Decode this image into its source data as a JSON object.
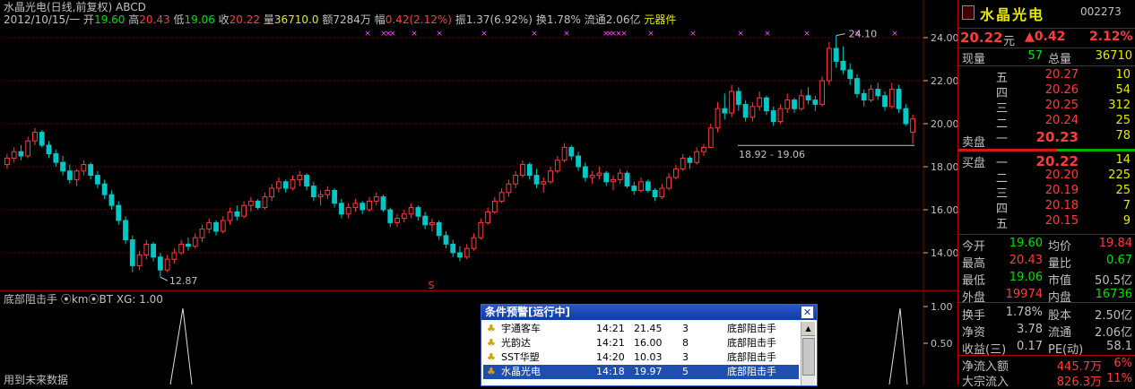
{
  "chart": {
    "title": "水晶光电(日线,前复权) ABCD",
    "info": {
      "date": "2012/10/15/一",
      "open_label": "开",
      "open": "19.60",
      "high_label": "高",
      "high": "20.43",
      "low_label": "低",
      "low": "19.06",
      "close_label": "收",
      "close": "20.22",
      "vol_label": "量",
      "vol": "36710.0",
      "amt_label": "额",
      "amt": "7284万",
      "chg_label": "幅",
      "chg": "0.42(2.12%)",
      "amp_label": "振",
      "amp": "1.37(6.92%)",
      "turn_label": "换",
      "turn": "1.78%",
      "float_label": "流通",
      "float": "2.06亿",
      "sector": "元器件"
    },
    "y_ticks": [
      "24.00",
      "22.00",
      "20.00",
      "18.00",
      "16.00",
      "14.00"
    ],
    "annotations": {
      "high_mark": "24.10",
      "low_mark": "12.87",
      "range": "18.92 - 19.06",
      "signal": "S"
    },
    "indicator": {
      "title": "底部阻击手 ⦿km⦿BT XG: 1.00",
      "ticks": [
        "1.00",
        "0.50"
      ]
    },
    "sub_text": "用到未来数据",
    "colors": {
      "up": "#ff3b3b",
      "down": "#00c8c8",
      "grid": "#800000",
      "marker": "#ff40ff"
    }
  },
  "chart_data": {
    "type": "candlestick",
    "y_range": [
      12.5,
      24.5
    ],
    "candles": [
      [
        18.1,
        18.6,
        17.9,
        18.4
      ],
      [
        18.4,
        18.9,
        18.2,
        18.7
      ],
      [
        18.7,
        19.0,
        18.3,
        18.5
      ],
      [
        18.5,
        19.4,
        18.4,
        19.2
      ],
      [
        19.2,
        19.8,
        19.0,
        19.6
      ],
      [
        19.6,
        19.7,
        18.9,
        19.0
      ],
      [
        19.0,
        19.2,
        18.4,
        18.6
      ],
      [
        18.6,
        18.8,
        18.0,
        18.2
      ],
      [
        18.2,
        18.5,
        17.6,
        17.8
      ],
      [
        17.8,
        18.1,
        17.2,
        17.4
      ],
      [
        17.4,
        17.9,
        17.1,
        17.8
      ],
      [
        17.8,
        18.3,
        17.6,
        18.1
      ],
      [
        18.1,
        18.2,
        17.4,
        17.6
      ],
      [
        17.6,
        17.8,
        17.0,
        17.2
      ],
      [
        17.2,
        17.4,
        16.5,
        16.7
      ],
      [
        16.7,
        16.9,
        16.0,
        16.2
      ],
      [
        16.2,
        16.4,
        15.3,
        15.5
      ],
      [
        15.5,
        15.7,
        14.4,
        14.6
      ],
      [
        14.6,
        14.8,
        13.1,
        13.4
      ],
      [
        13.4,
        14.1,
        13.2,
        13.9
      ],
      [
        13.9,
        14.6,
        13.7,
        14.4
      ],
      [
        14.4,
        14.5,
        13.6,
        13.8
      ],
      [
        13.8,
        14.0,
        12.87,
        13.2
      ],
      [
        13.2,
        13.9,
        13.1,
        13.7
      ],
      [
        13.7,
        14.2,
        13.5,
        14.0
      ],
      [
        14.0,
        14.6,
        13.9,
        14.4
      ],
      [
        14.4,
        14.7,
        14.1,
        14.3
      ],
      [
        14.3,
        14.9,
        14.2,
        14.7
      ],
      [
        14.7,
        15.3,
        14.5,
        15.1
      ],
      [
        15.1,
        15.6,
        14.9,
        15.4
      ],
      [
        15.4,
        15.5,
        14.8,
        15.0
      ],
      [
        15.0,
        15.7,
        14.9,
        15.5
      ],
      [
        15.5,
        16.1,
        15.3,
        15.9
      ],
      [
        15.9,
        16.2,
        15.5,
        15.7
      ],
      [
        15.7,
        16.4,
        15.6,
        16.2
      ],
      [
        16.2,
        16.6,
        15.9,
        16.4
      ],
      [
        16.4,
        16.5,
        16.0,
        16.1
      ],
      [
        16.1,
        16.8,
        16.0,
        16.6
      ],
      [
        16.6,
        17.2,
        16.4,
        17.0
      ],
      [
        17.0,
        17.5,
        16.8,
        17.3
      ],
      [
        17.3,
        17.4,
        16.8,
        17.0
      ],
      [
        17.0,
        17.6,
        16.9,
        17.4
      ],
      [
        17.4,
        17.8,
        17.1,
        17.6
      ],
      [
        17.6,
        17.7,
        16.9,
        17.1
      ],
      [
        17.1,
        17.3,
        16.4,
        16.6
      ],
      [
        16.6,
        16.9,
        16.2,
        16.7
      ],
      [
        16.7,
        17.1,
        16.5,
        16.9
      ],
      [
        16.9,
        17.0,
        16.1,
        16.3
      ],
      [
        16.3,
        16.5,
        15.6,
        15.8
      ],
      [
        15.8,
        16.3,
        15.6,
        16.1
      ],
      [
        16.1,
        16.5,
        15.9,
        16.3
      ],
      [
        16.3,
        16.4,
        15.8,
        16.0
      ],
      [
        16.0,
        16.6,
        15.9,
        16.4
      ],
      [
        16.4,
        16.8,
        16.2,
        16.6
      ],
      [
        16.6,
        16.7,
        15.9,
        16.0
      ],
      [
        16.0,
        16.1,
        15.2,
        15.4
      ],
      [
        15.4,
        15.8,
        15.2,
        15.6
      ],
      [
        15.6,
        16.0,
        15.4,
        15.8
      ],
      [
        15.8,
        16.3,
        15.6,
        16.1
      ],
      [
        16.1,
        16.2,
        15.5,
        15.7
      ],
      [
        15.7,
        15.9,
        15.1,
        15.3
      ],
      [
        15.3,
        15.6,
        15.0,
        15.4
      ],
      [
        15.4,
        15.5,
        14.6,
        14.8
      ],
      [
        14.8,
        15.0,
        14.2,
        14.4
      ],
      [
        14.4,
        14.6,
        13.8,
        14.0
      ],
      [
        14.0,
        14.3,
        13.6,
        13.8
      ],
      [
        13.8,
        14.4,
        13.7,
        14.2
      ],
      [
        14.2,
        14.9,
        14.1,
        14.7
      ],
      [
        14.7,
        15.6,
        14.6,
        15.4
      ],
      [
        15.4,
        16.1,
        15.3,
        15.9
      ],
      [
        15.9,
        16.6,
        15.8,
        16.4
      ],
      [
        16.4,
        17.0,
        16.3,
        16.8
      ],
      [
        16.8,
        17.4,
        16.6,
        17.2
      ],
      [
        17.2,
        17.8,
        17.0,
        17.6
      ],
      [
        17.6,
        18.3,
        17.5,
        18.1
      ],
      [
        18.1,
        18.2,
        17.4,
        17.6
      ],
      [
        17.6,
        17.9,
        17.0,
        17.2
      ],
      [
        17.2,
        17.5,
        16.8,
        17.3
      ],
      [
        17.3,
        18.0,
        17.2,
        17.8
      ],
      [
        17.8,
        18.5,
        17.7,
        18.3
      ],
      [
        18.3,
        19.1,
        18.2,
        18.9
      ],
      [
        18.9,
        19.0,
        18.3,
        18.5
      ],
      [
        18.5,
        18.7,
        17.8,
        18.0
      ],
      [
        18.0,
        18.2,
        17.3,
        17.5
      ],
      [
        17.5,
        17.8,
        17.2,
        17.6
      ],
      [
        17.6,
        18.0,
        17.4,
        17.7
      ],
      [
        17.7,
        17.8,
        17.1,
        17.3
      ],
      [
        17.3,
        17.6,
        16.9,
        17.4
      ],
      [
        17.4,
        17.9,
        17.2,
        17.7
      ],
      [
        17.7,
        17.8,
        17.0,
        17.1
      ],
      [
        17.1,
        17.3,
        16.7,
        16.9
      ],
      [
        16.9,
        17.5,
        16.8,
        17.3
      ],
      [
        17.3,
        17.4,
        16.8,
        16.9
      ],
      [
        16.9,
        17.0,
        16.4,
        16.6
      ],
      [
        16.6,
        17.2,
        16.5,
        17.0
      ],
      [
        17.0,
        17.7,
        16.9,
        17.5
      ],
      [
        17.5,
        18.1,
        17.4,
        17.9
      ],
      [
        17.9,
        18.6,
        17.8,
        18.4
      ],
      [
        18.4,
        18.5,
        17.9,
        18.2
      ],
      [
        18.2,
        18.9,
        18.1,
        18.7
      ],
      [
        18.7,
        19.06,
        18.5,
        18.9
      ],
      [
        18.9,
        20.0,
        18.92,
        19.8
      ],
      [
        19.8,
        21.0,
        19.6,
        20.7
      ],
      [
        20.7,
        21.4,
        20.2,
        20.5
      ],
      [
        20.5,
        21.8,
        20.3,
        21.5
      ],
      [
        21.5,
        21.7,
        20.6,
        20.9
      ],
      [
        20.9,
        21.1,
        20.1,
        20.3
      ],
      [
        20.3,
        21.0,
        20.1,
        20.8
      ],
      [
        20.8,
        21.5,
        20.6,
        21.2
      ],
      [
        21.2,
        21.3,
        20.4,
        20.6
      ],
      [
        20.6,
        20.8,
        19.9,
        20.1
      ],
      [
        20.1,
        20.9,
        20.0,
        20.7
      ],
      [
        20.7,
        21.4,
        20.5,
        21.1
      ],
      [
        21.1,
        21.2,
        20.5,
        20.7
      ],
      [
        20.7,
        21.6,
        20.6,
        21.3
      ],
      [
        21.3,
        21.7,
        20.9,
        21.1
      ],
      [
        21.1,
        21.3,
        20.6,
        20.9
      ],
      [
        20.9,
        22.2,
        20.8,
        22.0
      ],
      [
        22.0,
        23.8,
        21.8,
        23.5
      ],
      [
        23.5,
        24.1,
        22.6,
        22.9
      ],
      [
        22.9,
        23.6,
        22.3,
        22.5
      ],
      [
        22.5,
        22.8,
        21.8,
        22.1
      ],
      [
        22.1,
        22.3,
        21.2,
        21.4
      ],
      [
        21.4,
        21.6,
        20.8,
        21.1
      ],
      [
        21.1,
        21.8,
        21.0,
        21.6
      ],
      [
        21.6,
        21.9,
        21.1,
        21.3
      ],
      [
        21.3,
        21.5,
        20.6,
        20.8
      ],
      [
        20.8,
        21.9,
        20.7,
        21.6
      ],
      [
        21.6,
        21.8,
        20.5,
        20.7
      ],
      [
        20.7,
        20.9,
        19.9,
        20.0
      ],
      [
        19.6,
        20.43,
        19.06,
        20.22
      ]
    ]
  },
  "order_book": {
    "name": "水晶光电",
    "code": "002273",
    "price": "20.22",
    "price_unit": "元",
    "change": "▲0.42",
    "change_pct": "2.12%",
    "now_vol_label": "现量",
    "now_vol": "57",
    "total_vol_label": "总量",
    "total_vol": "36710",
    "sell": [
      {
        "lv": "五",
        "p": "20.27",
        "v": "10"
      },
      {
        "lv": "四",
        "p": "20.26",
        "v": "54"
      },
      {
        "lv": "三",
        "p": "20.25",
        "v": "312"
      },
      {
        "lv": "二",
        "p": "20.24",
        "v": "25"
      },
      {
        "lv": "一",
        "p": "20.23",
        "v": "78"
      }
    ],
    "sell_label": "卖盘",
    "buy_label": "买盘",
    "buy": [
      {
        "lv": "一",
        "p": "20.22",
        "v": "14"
      },
      {
        "lv": "二",
        "p": "20.20",
        "v": "225"
      },
      {
        "lv": "三",
        "p": "20.19",
        "v": "25"
      },
      {
        "lv": "四",
        "p": "20.18",
        "v": "7"
      },
      {
        "lv": "五",
        "p": "20.15",
        "v": "9"
      }
    ],
    "stats": [
      {
        "l1": "今开",
        "v1": "19.60",
        "c1": "g",
        "l2": "均价",
        "v2": "19.84",
        "c2": "r"
      },
      {
        "l1": "最高",
        "v1": "20.43",
        "c1": "r",
        "l2": "量比",
        "v2": "0.67",
        "c2": "g"
      },
      {
        "l1": "最低",
        "v1": "19.06",
        "c1": "g",
        "l2": "市值",
        "v2": "50.5亿",
        "c2": "w"
      },
      {
        "l1": "外盘",
        "v1": "19974",
        "c1": "r",
        "l2": "内盘",
        "v2": "16736",
        "c2": "g"
      }
    ],
    "stats2": [
      {
        "l1": "换手",
        "v1": "1.78%",
        "c1": "w",
        "l2": "股本",
        "v2": "2.50亿",
        "c2": "w"
      },
      {
        "l1": "净资",
        "v1": "3.78",
        "c1": "w",
        "l2": "流通",
        "v2": "2.06亿",
        "c2": "w"
      },
      {
        "l1": "收益(三)",
        "v1": "0.17",
        "c1": "w",
        "l2": "PE(动)",
        "v2": "58.1",
        "c2": "w"
      }
    ],
    "net_inflow_label": "净流入额",
    "net_inflow": "445.7万",
    "net_inflow_pct": "6%",
    "big_inflow_label": "大宗流入",
    "big_inflow": "826.3万",
    "big_inflow_pct": "11%"
  },
  "alert": {
    "title": "条件预警[运行中]",
    "rows": [
      {
        "name": "宇通客车",
        "time": "14:21",
        "price": "21.45",
        "n": "3",
        "cond": "底部阻击手"
      },
      {
        "name": "光韵达",
        "time": "14:21",
        "price": "16.00",
        "n": "8",
        "cond": "底部阻击手"
      },
      {
        "name": "SST华塑",
        "time": "14:20",
        "price": "10.03",
        "n": "3",
        "cond": "底部阻击手"
      },
      {
        "name": "水晶光电",
        "time": "14:18",
        "price": "19.97",
        "n": "5",
        "cond": "底部阻击手"
      }
    ]
  }
}
